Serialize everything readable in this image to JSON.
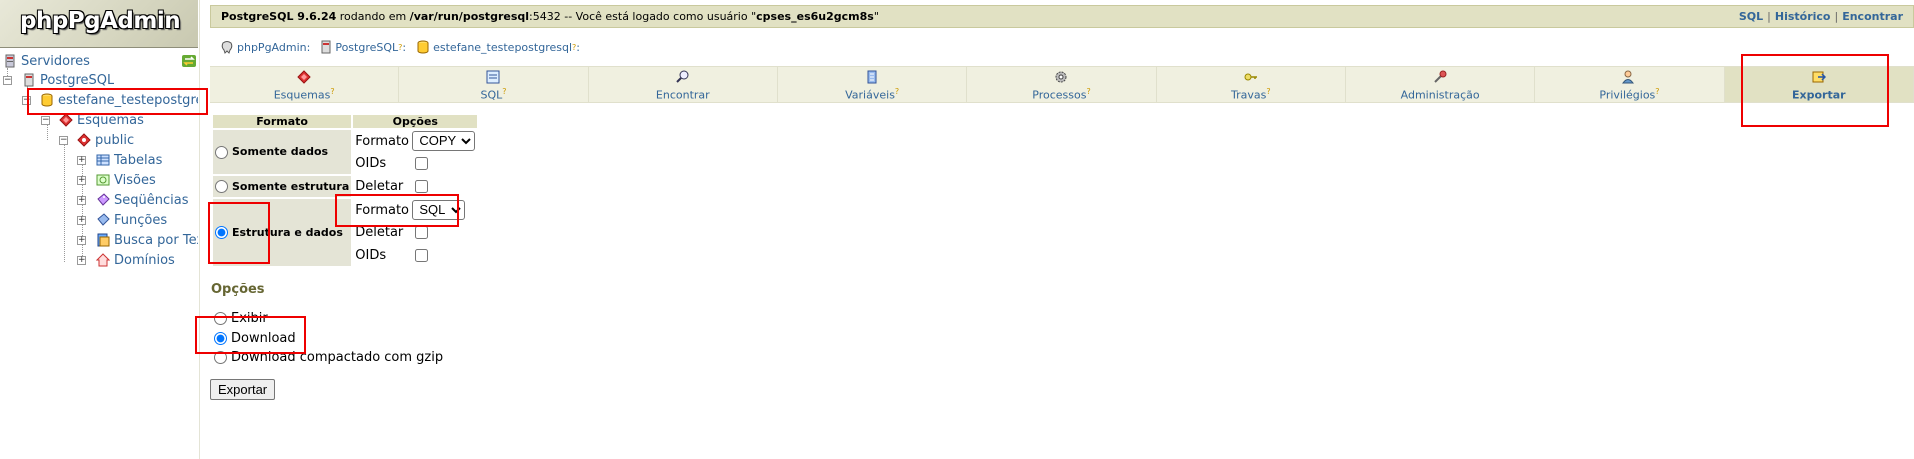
{
  "logo": {
    "text": "phpPgAdmin"
  },
  "tree": {
    "servers": "Servidores",
    "server": "PostgreSQL",
    "database": "estefane_testepostgresql",
    "schemas": "Esquemas",
    "schema": "public",
    "children": [
      "Tabelas",
      "Visões",
      "Seqüências",
      "Funções",
      "Busca por Texto",
      "Domínios"
    ]
  },
  "topbar": {
    "version": "PostgreSQL 9.6.24",
    "running_on": " rodando em ",
    "socket": "/var/run/postgresql",
    "port_text": ":5432 -- Você está logado como usuário \"",
    "user": "cpses_es6u2gcm8s",
    "quote_end": "\"",
    "links": [
      "SQL",
      "Histórico",
      "Encontrar"
    ]
  },
  "trail": {
    "items": [
      "phpPgAdmin",
      "PostgreSQL",
      "estefane_testepostgresql"
    ],
    "help_mark": "?",
    "colon": ":"
  },
  "tabs": [
    {
      "label": "Esquemas",
      "help": "?"
    },
    {
      "label": "SQL",
      "help": "?"
    },
    {
      "label": "Encontrar",
      "help": ""
    },
    {
      "label": "Variáveis",
      "help": "?"
    },
    {
      "label": "Processos",
      "help": "?"
    },
    {
      "label": "Travas",
      "help": "?"
    },
    {
      "label": "Administração",
      "help": ""
    },
    {
      "label": "Privilégios",
      "help": "?"
    },
    {
      "label": "Exportar",
      "help": ""
    }
  ],
  "export_table": {
    "headers": [
      "Formato",
      "Opções"
    ],
    "data_only": {
      "label": "Somente dados",
      "format_label": "Formato",
      "format_value": "COPY",
      "oids_label": "OIDs"
    },
    "structure_only": {
      "label": "Somente estrutura",
      "drop_label": "Deletar"
    },
    "structure_and_data": {
      "label": "Estrutura e dados",
      "format_label": "Formato",
      "format_value": "SQL",
      "drop_label": "Deletar",
      "oids_label": "OIDs",
      "selected": true
    }
  },
  "options": {
    "heading": "Opções",
    "items": [
      "Exibir",
      "Download",
      "Download compactado com gzip"
    ],
    "selected": "Download"
  },
  "export_button": "Exportar",
  "colors": {
    "bar_bg": "#e1e1c3",
    "link": "#336699",
    "annotation": "#ee0000"
  }
}
